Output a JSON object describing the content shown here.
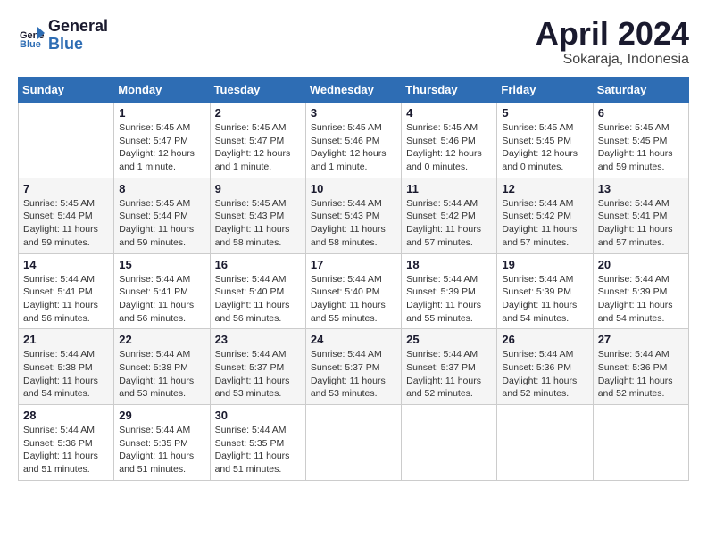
{
  "header": {
    "logo_general": "General",
    "logo_blue": "Blue",
    "month_title": "April 2024",
    "location": "Sokaraja, Indonesia"
  },
  "weekdays": [
    "Sunday",
    "Monday",
    "Tuesday",
    "Wednesday",
    "Thursday",
    "Friday",
    "Saturday"
  ],
  "weeks": [
    [
      {
        "day": "",
        "info": ""
      },
      {
        "day": "1",
        "info": "Sunrise: 5:45 AM\nSunset: 5:47 PM\nDaylight: 12 hours\nand 1 minute."
      },
      {
        "day": "2",
        "info": "Sunrise: 5:45 AM\nSunset: 5:47 PM\nDaylight: 12 hours\nand 1 minute."
      },
      {
        "day": "3",
        "info": "Sunrise: 5:45 AM\nSunset: 5:46 PM\nDaylight: 12 hours\nand 1 minute."
      },
      {
        "day": "4",
        "info": "Sunrise: 5:45 AM\nSunset: 5:46 PM\nDaylight: 12 hours\nand 0 minutes."
      },
      {
        "day": "5",
        "info": "Sunrise: 5:45 AM\nSunset: 5:45 PM\nDaylight: 12 hours\nand 0 minutes."
      },
      {
        "day": "6",
        "info": "Sunrise: 5:45 AM\nSunset: 5:45 PM\nDaylight: 11 hours\nand 59 minutes."
      }
    ],
    [
      {
        "day": "7",
        "info": ""
      },
      {
        "day": "8",
        "info": "Sunrise: 5:45 AM\nSunset: 5:44 PM\nDaylight: 11 hours\nand 59 minutes."
      },
      {
        "day": "9",
        "info": "Sunrise: 5:45 AM\nSunset: 5:43 PM\nDaylight: 11 hours\nand 58 minutes."
      },
      {
        "day": "10",
        "info": "Sunrise: 5:44 AM\nSunset: 5:43 PM\nDaylight: 11 hours\nand 58 minutes."
      },
      {
        "day": "11",
        "info": "Sunrise: 5:44 AM\nSunset: 5:42 PM\nDaylight: 11 hours\nand 57 minutes."
      },
      {
        "day": "12",
        "info": "Sunrise: 5:44 AM\nSunset: 5:42 PM\nDaylight: 11 hours\nand 57 minutes."
      },
      {
        "day": "13",
        "info": "Sunrise: 5:44 AM\nSunset: 5:41 PM\nDaylight: 11 hours\nand 57 minutes."
      }
    ],
    [
      {
        "day": "14",
        "info": ""
      },
      {
        "day": "15",
        "info": "Sunrise: 5:44 AM\nSunset: 5:41 PM\nDaylight: 11 hours\nand 56 minutes."
      },
      {
        "day": "16",
        "info": "Sunrise: 5:44 AM\nSunset: 5:40 PM\nDaylight: 11 hours\nand 56 minutes."
      },
      {
        "day": "17",
        "info": "Sunrise: 5:44 AM\nSunset: 5:40 PM\nDaylight: 11 hours\nand 55 minutes."
      },
      {
        "day": "18",
        "info": "Sunrise: 5:44 AM\nSunset: 5:39 PM\nDaylight: 11 hours\nand 55 minutes."
      },
      {
        "day": "19",
        "info": "Sunrise: 5:44 AM\nSunset: 5:39 PM\nDaylight: 11 hours\nand 54 minutes."
      },
      {
        "day": "20",
        "info": "Sunrise: 5:44 AM\nSunset: 5:39 PM\nDaylight: 11 hours\nand 54 minutes."
      }
    ],
    [
      {
        "day": "21",
        "info": ""
      },
      {
        "day": "22",
        "info": "Sunrise: 5:44 AM\nSunset: 5:38 PM\nDaylight: 11 hours\nand 53 minutes."
      },
      {
        "day": "23",
        "info": "Sunrise: 5:44 AM\nSunset: 5:37 PM\nDaylight: 11 hours\nand 53 minutes."
      },
      {
        "day": "24",
        "info": "Sunrise: 5:44 AM\nSunset: 5:37 PM\nDaylight: 11 hours\nand 53 minutes."
      },
      {
        "day": "25",
        "info": "Sunrise: 5:44 AM\nSunset: 5:37 PM\nDaylight: 11 hours\nand 52 minutes."
      },
      {
        "day": "26",
        "info": "Sunrise: 5:44 AM\nSunset: 5:36 PM\nDaylight: 11 hours\nand 52 minutes."
      },
      {
        "day": "27",
        "info": "Sunrise: 5:44 AM\nSunset: 5:36 PM\nDaylight: 11 hours\nand 52 minutes."
      }
    ],
    [
      {
        "day": "28",
        "info": "Sunrise: 5:44 AM\nSunset: 5:36 PM\nDaylight: 11 hours\nand 51 minutes."
      },
      {
        "day": "29",
        "info": "Sunrise: 5:44 AM\nSunset: 5:35 PM\nDaylight: 11 hours\nand 51 minutes."
      },
      {
        "day": "30",
        "info": "Sunrise: 5:44 AM\nSunset: 5:35 PM\nDaylight: 11 hours\nand 51 minutes."
      },
      {
        "day": "",
        "info": ""
      },
      {
        "day": "",
        "info": ""
      },
      {
        "day": "",
        "info": ""
      },
      {
        "day": "",
        "info": ""
      }
    ]
  ],
  "week1_day7_info": "Sunrise: 5:45 AM\nSunset: 5:44 PM\nDaylight: 11 hours\nand 59 minutes.",
  "week2_day14_info": "Sunrise: 5:44 AM\nSunset: 5:41 PM\nDaylight: 11 hours\nand 56 minutes.",
  "week3_day21_info": "Sunrise: 5:44 AM\nSunset: 5:38 PM\nDaylight: 11 hours\nand 54 minutes."
}
